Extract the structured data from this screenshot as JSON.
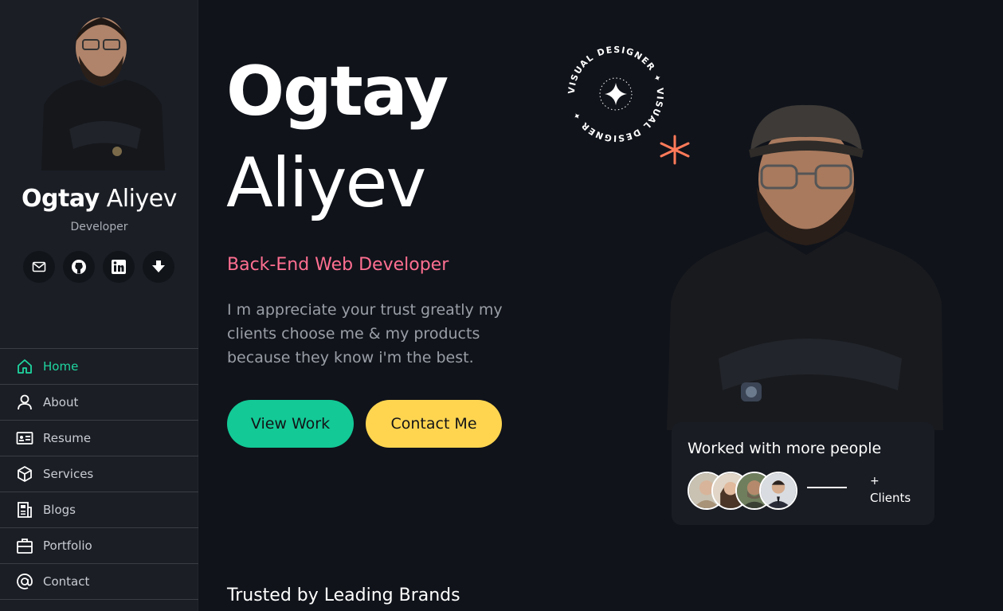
{
  "sidebar": {
    "name_first": "Ogtay",
    "name_last": "Aliyev",
    "role": "Developer",
    "socials": [
      {
        "icon": "mail-icon"
      },
      {
        "icon": "github-icon"
      },
      {
        "icon": "linkedin-icon"
      },
      {
        "icon": "download-icon"
      }
    ],
    "nav": [
      {
        "label": "Home",
        "icon": "home-icon",
        "active": true
      },
      {
        "label": "About",
        "icon": "user-icon",
        "active": false
      },
      {
        "label": "Resume",
        "icon": "id-card-icon",
        "active": false
      },
      {
        "label": "Services",
        "icon": "cube-icon",
        "active": false
      },
      {
        "label": "Blogs",
        "icon": "newspaper-icon",
        "active": false
      },
      {
        "label": "Portfolio",
        "icon": "briefcase-icon",
        "active": false
      },
      {
        "label": "Contact",
        "icon": "at-icon",
        "active": false
      }
    ]
  },
  "hero": {
    "first_name": "Ogtay",
    "last_name": "Aliyev",
    "subtitle": "Back-End Web Developer",
    "description": "I m appreciate your trust greatly my clients choose me & my products because they know i'm the best.",
    "view_work_label": "View Work",
    "contact_label": "Contact Me",
    "badge_text": "VISUAL DESIGNER ✦ VISUAL DESIGNER ✦"
  },
  "card": {
    "title": "Worked with more people",
    "plus": "+",
    "clients": "Clients"
  },
  "trusted": {
    "title": "Trusted by Leading Brands"
  },
  "colors": {
    "background": "#10131a",
    "sidebar": "#1b1e25",
    "accent_green": "#13c996",
    "accent_yellow": "#ffd550",
    "accent_pink": "#ff6f91",
    "asterisk": "#ff7a59"
  }
}
